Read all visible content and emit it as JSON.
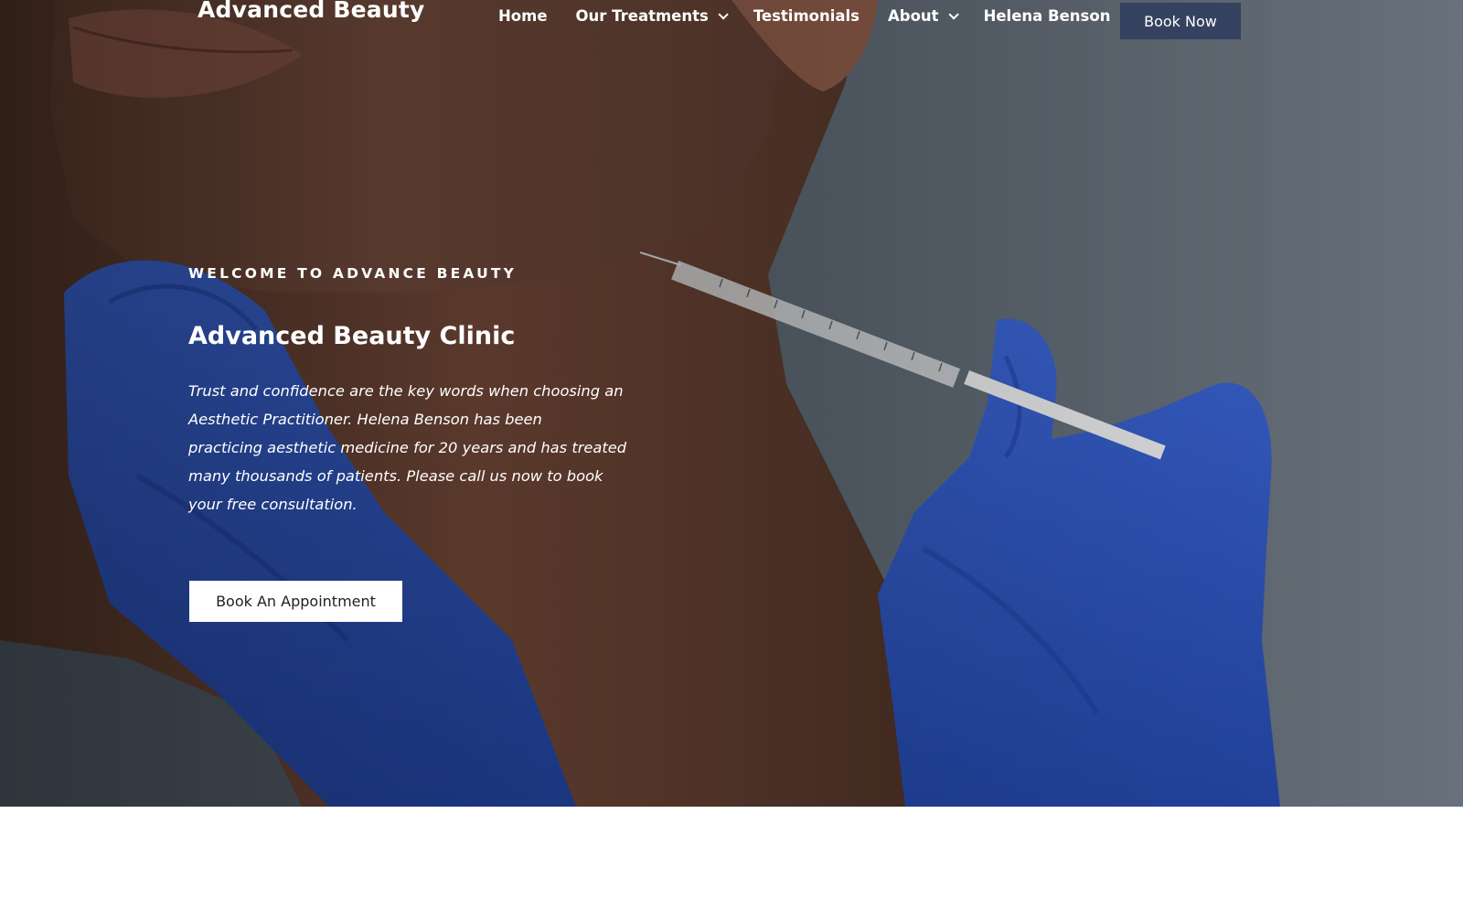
{
  "header": {
    "logo": "Advanced Beauty",
    "nav": [
      {
        "label": "Home",
        "has_dropdown": false
      },
      {
        "label": "Our Treatments",
        "has_dropdown": true
      },
      {
        "label": "Testimonials",
        "has_dropdown": false
      },
      {
        "label": "About",
        "has_dropdown": true
      },
      {
        "label": "Helena Benson",
        "has_dropdown": false
      }
    ],
    "book_now_label": "Book Now",
    "book_now_color": "#34415f"
  },
  "hero": {
    "kicker": "WELCOME TO ADVANCE BEAUTY",
    "title": "Advanced Beauty Clinic",
    "body": "Trust and confidence are the key words when choosing an\nAesthetic Practitioner.  Helena Benson has been\npracticing aesthetic medicine for 20 years and has treated\nmany thousands of patients. Please call us now to book\nyour free consultation.",
    "cta_label": "Book An Appointment",
    "glove_color": "#2f56c6"
  }
}
